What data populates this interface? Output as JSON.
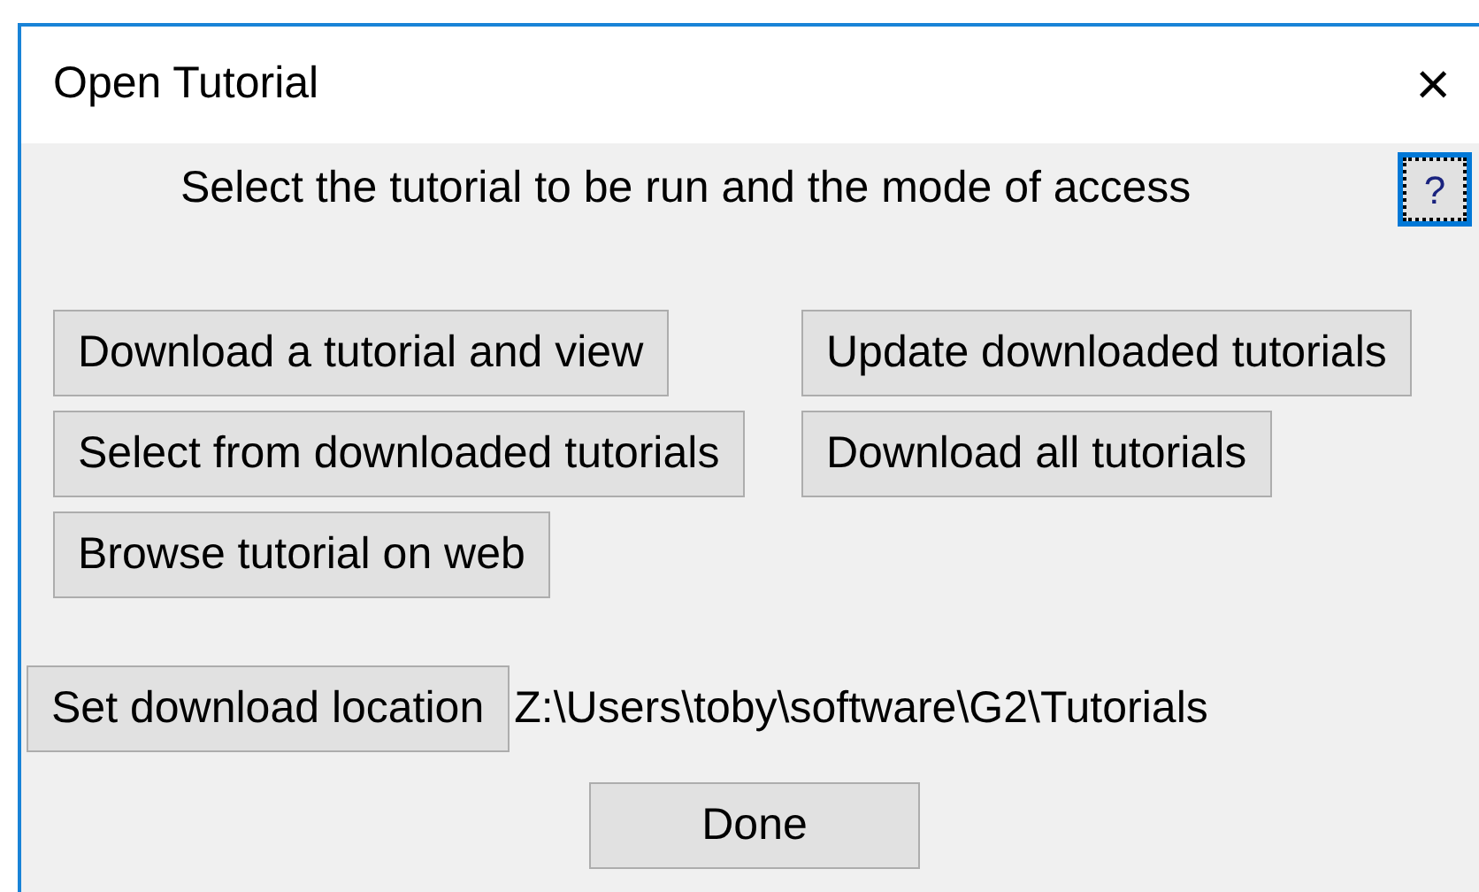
{
  "window": {
    "title": "Open Tutorial",
    "close": "×"
  },
  "prompt": "Select the tutorial to be run and the mode of access",
  "help_button": {
    "label": "?",
    "focused": true
  },
  "button_columns": [
    [
      "Download a tutorial and view",
      "Select from downloaded tutorials",
      "Browse tutorial on web"
    ],
    [
      "Update downloaded tutorials",
      "Download all tutorials"
    ]
  ],
  "location": {
    "button": "Set download location",
    "path": "Z:\\Users\\toby\\software\\G2\\Tutorials"
  },
  "done_button": "Done"
}
